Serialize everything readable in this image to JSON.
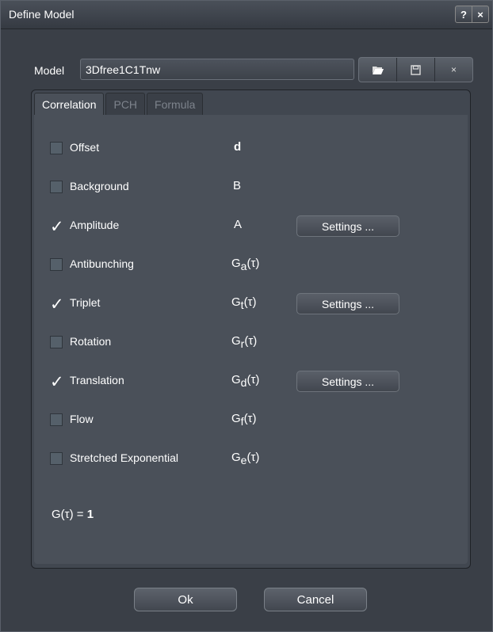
{
  "window": {
    "title": "Define Model",
    "help_label": "?",
    "close_label": "×"
  },
  "model": {
    "label": "Model",
    "value": "3Dfree1C1Tnw",
    "open_icon": "folder-open-icon",
    "save_icon": "save-icon",
    "delete_label": "×"
  },
  "tabs": [
    {
      "label": "Correlation",
      "active": true
    },
    {
      "label": "PCH",
      "active": false
    },
    {
      "label": "Formula",
      "active": false
    }
  ],
  "rows": [
    {
      "label": "Offset",
      "checked": false,
      "symbol": "d",
      "sub": "",
      "settings": ""
    },
    {
      "label": "Background",
      "checked": false,
      "symbol": "B",
      "sub": "",
      "settings": ""
    },
    {
      "label": "Amplitude",
      "checked": true,
      "symbol": "A",
      "sub": "",
      "settings": "Settings ..."
    },
    {
      "label": "Antibunching",
      "checked": false,
      "symbol": "G",
      "sub": "a",
      "settings": ""
    },
    {
      "label": "Triplet",
      "checked": true,
      "symbol": "G",
      "sub": "t",
      "settings": "Settings ..."
    },
    {
      "label": "Rotation",
      "checked": false,
      "symbol": "G",
      "sub": "r",
      "settings": ""
    },
    {
      "label": "Translation",
      "checked": true,
      "symbol": "G",
      "sub": "d",
      "settings": "Settings ..."
    },
    {
      "label": "Flow",
      "checked": false,
      "symbol": "G",
      "sub": "f",
      "settings": ""
    },
    {
      "label": "Stretched Exponential",
      "checked": false,
      "symbol": "G",
      "sub": "e",
      "settings": ""
    }
  ],
  "tau": "(τ)",
  "formula": {
    "lhs": "G(τ) = ",
    "value": "1"
  },
  "buttons": {
    "ok": "Ok",
    "cancel": "Cancel"
  }
}
